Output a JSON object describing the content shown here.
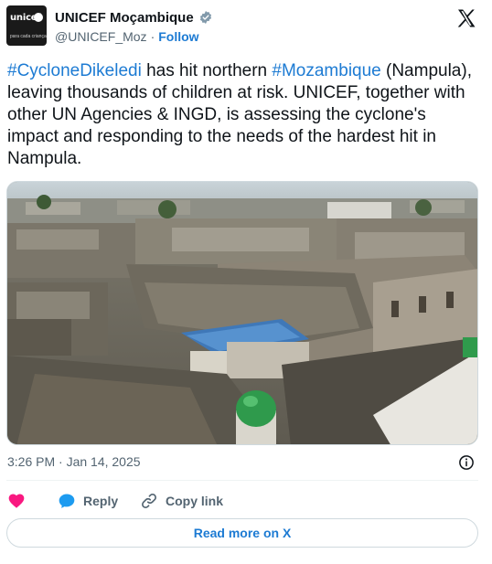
{
  "author": {
    "display_name": "UNICEF Moçambique",
    "handle": "@UNICEF_Moz",
    "separator": "·",
    "follow_label": "Follow",
    "avatar_logo_text": "unicef",
    "avatar_tagline": "para cada criança",
    "verified_icon": "verified-badge-icon"
  },
  "tweet": {
    "segments": [
      {
        "text": "#CycloneDikeledi",
        "type": "hashtag"
      },
      {
        "text": " has hit northern ",
        "type": "text"
      },
      {
        "text": "#Mozambique",
        "type": "hashtag"
      },
      {
        "text": " (Nampula), leaving thousands of children at risk. UNICEF, together with other UN Agencies & INGD, is assessing the cyclone's impact and responding to the needs of the hardest hit in Nampula.",
        "type": "text"
      }
    ],
    "photo_icon": "cyclone-damage-photo",
    "timestamp": "3:26 PM · Jan 14, 2025"
  },
  "actions": {
    "like_icon": "heart-icon",
    "reply_label": "Reply",
    "copy_link_label": "Copy link"
  },
  "read_more_label": "Read more on X",
  "colors": {
    "link": "#1d7bd3",
    "heart": "#f91880",
    "muted": "#536471",
    "text": "#0f1419",
    "verified": "#829aab"
  }
}
